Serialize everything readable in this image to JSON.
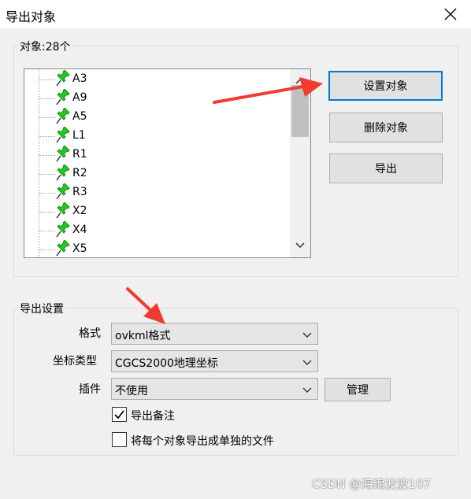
{
  "window": {
    "title": "导出对象"
  },
  "objects_group": {
    "label": "对象:28个",
    "items": [
      {
        "label": "A3"
      },
      {
        "label": "A9"
      },
      {
        "label": "A5"
      },
      {
        "label": "L1"
      },
      {
        "label": "R1"
      },
      {
        "label": "R2"
      },
      {
        "label": "R3"
      },
      {
        "label": "X2"
      },
      {
        "label": "X4"
      },
      {
        "label": "X5"
      }
    ],
    "buttons": {
      "set": "设置对象",
      "delete": "删除对象",
      "export": "导出"
    }
  },
  "export_settings": {
    "label": "导出设置",
    "format": {
      "label": "格式",
      "value": "ovkml格式"
    },
    "coord_type": {
      "label": "坐标类型",
      "value": "CGCS2000地理坐标"
    },
    "plugin": {
      "label": "插件",
      "value": "不使用",
      "manage": "管理"
    },
    "export_notes": {
      "label": "导出备注",
      "checked": true
    },
    "separate_files": {
      "label": "将每个对象导出成单独的文件",
      "checked": false
    }
  },
  "colors": {
    "pin": "#1ecb1e",
    "annotation_arrow": "#f03c2e",
    "accent": "#0078d7"
  },
  "watermark": "CSDN @海绵波波107"
}
